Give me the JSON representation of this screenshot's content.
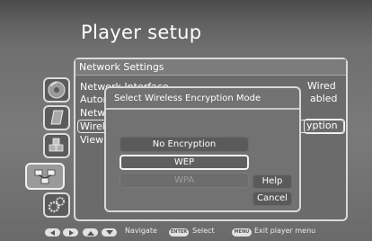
{
  "screen": {
    "title": "Player setup"
  },
  "panel": {
    "header": "Network Settings",
    "menu_items": [
      {
        "label": "Network Interface",
        "value": "Wired"
      },
      {
        "label": "Autom",
        "value": "abled"
      },
      {
        "label": "Netwo",
        "value": ""
      },
      {
        "label": "Wirele",
        "value": "yption"
      },
      {
        "label": "View",
        "value": ""
      }
    ]
  },
  "sidebar": {
    "icons": [
      {
        "name": "disc-icon"
      },
      {
        "name": "document-icon"
      },
      {
        "name": "cubes-icon"
      },
      {
        "name": "network-icon"
      },
      {
        "name": "gears-icon"
      }
    ]
  },
  "dialog": {
    "title": "Select Wireless Encryption Mode",
    "options": [
      {
        "label": "No Encryption",
        "state": "normal"
      },
      {
        "label": "WEP",
        "state": "selected"
      },
      {
        "label": "WPA",
        "state": "disabled"
      }
    ],
    "help_label": "Help",
    "cancel_label": "Cancel"
  },
  "footer": {
    "navigate_label": "Navigate",
    "select_key": "ENTER",
    "select_label": "Select",
    "exit_key": "MENU",
    "exit_label": "Exit player menu"
  },
  "colors": {
    "background": "#6f6f6f",
    "border": "#d9d9d9",
    "text": "#ffffff"
  }
}
